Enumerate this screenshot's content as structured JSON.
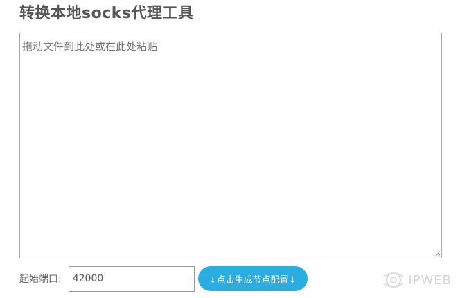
{
  "title": "转换本地socks代理工具",
  "textarea": {
    "placeholder": "拖动文件到此处或在此处粘贴",
    "value": ""
  },
  "port": {
    "label": "起始端口:",
    "value": "42000"
  },
  "generate_button": {
    "label": "↓点击生成节点配置↓",
    "color": "#2aaee2"
  },
  "watermark": {
    "text": "IPWEB",
    "icon": "ipweb-logo-icon"
  }
}
